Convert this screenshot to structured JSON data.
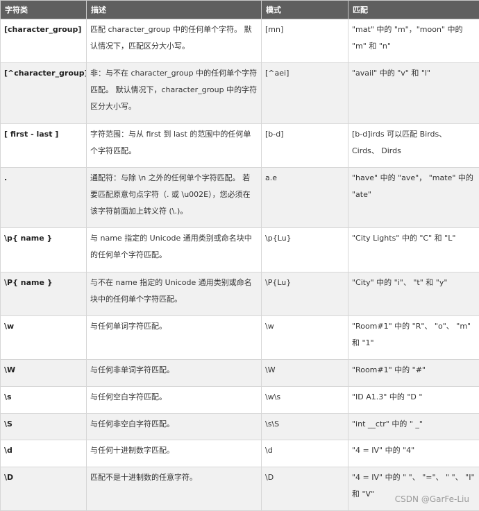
{
  "header": {
    "col1": "字符类",
    "col2": "描述",
    "col3": "模式",
    "col4": "匹配"
  },
  "rows": [
    {
      "element": "[character_group]",
      "desc": "匹配 character_group 中的任何单个字符。 默认情况下，匹配区分大小写。",
      "pattern": "[mn]",
      "match": "\"mat\" 中的 \"m\"，\"moon\" 中的 \"m\" 和 \"n\""
    },
    {
      "element": "[^character_group]",
      "desc": "非：与不在 character_group 中的任何单个字符匹配。 默认情况下，character_group 中的字符区分大小写。",
      "pattern": "[^aei]",
      "match": "\"avail\" 中的 \"v\" 和 \"l\""
    },
    {
      "element": "[ first - last ]",
      "desc": "字符范围：与从 first 到 last 的范围中的任何单个字符匹配。",
      "pattern": "[b-d]",
      "match": "[b-d]irds 可以匹配 Birds、 Cirds、 Dirds"
    },
    {
      "element": ".",
      "desc": "通配符：与除 \\n 之外的任何单个字符匹配。 若要匹配原意句点字符（. 或 \\u002E），您必须在该字符前面加上转义符 (\\.)。",
      "pattern": "a.e",
      "match": "\"have\" 中的 \"ave\"， \"mate\" 中的 \"ate\""
    },
    {
      "element": "\\p{ name }",
      "desc": "与 name 指定的 Unicode 通用类别或命名块中的任何单个字符匹配。",
      "pattern": "\\p{Lu}",
      "match": "\"City Lights\" 中的 \"C\" 和 \"L\""
    },
    {
      "element": "\\P{ name }",
      "desc": "与不在 name 指定的 Unicode 通用类别或命名块中的任何单个字符匹配。",
      "pattern": "\\P{Lu}",
      "match": "\"City\" 中的 \"i\"、 \"t\" 和 \"y\""
    },
    {
      "element": "\\w",
      "desc": "与任何单词字符匹配。",
      "pattern": "\\w",
      "match": "\"Room#1\" 中的 \"R\"、 \"o\"、 \"m\" 和 \"1\""
    },
    {
      "element": "\\W",
      "desc": "与任何非单词字符匹配。",
      "pattern": "\\W",
      "match": "\"Room#1\" 中的 \"#\""
    },
    {
      "element": "\\s",
      "desc": "与任何空白字符匹配。",
      "pattern": "\\w\\s",
      "match": "\"ID A1.3\" 中的 \"D \""
    },
    {
      "element": "\\S",
      "desc": "与任何非空白字符匹配。",
      "pattern": "\\s\\S",
      "match": "\"int __ctr\" 中的 \" _\""
    },
    {
      "element": "\\d",
      "desc": "与任何十进制数字匹配。",
      "pattern": "\\d",
      "match": "\"4 = IV\" 中的 \"4\""
    },
    {
      "element": "\\D",
      "desc": "匹配不是十进制数的任意字符。",
      "pattern": "\\D",
      "match": "\"4 = IV\" 中的 \" \"、 \"=\"、 \" \"、 \"I\" 和 \"V\""
    }
  ],
  "watermark": "CSDN @GarFe-Liu"
}
